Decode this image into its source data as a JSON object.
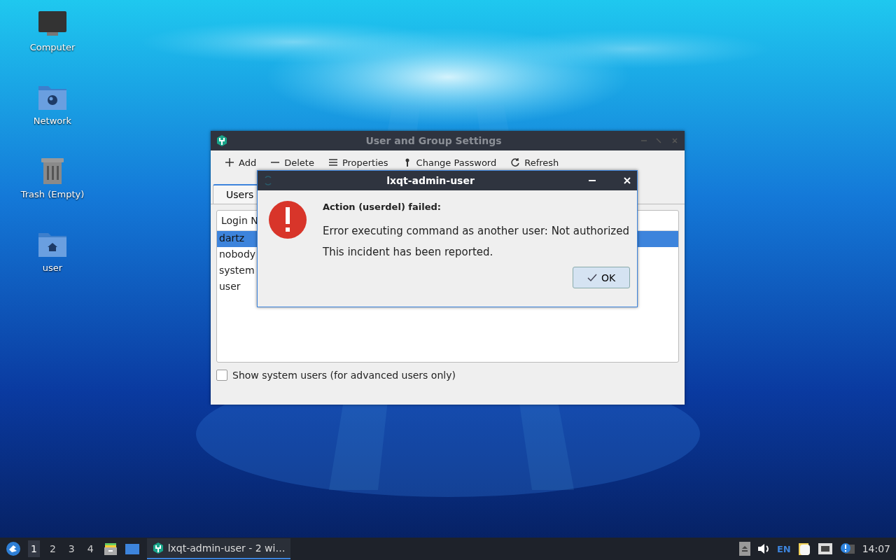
{
  "desktop_icons": [
    {
      "kind": "computer",
      "label": "Computer"
    },
    {
      "kind": "network",
      "label": "Network"
    },
    {
      "kind": "trash",
      "label": "Trash (Empty)"
    },
    {
      "kind": "home",
      "label": "user"
    }
  ],
  "main_window": {
    "title": "User and Group Settings",
    "toolbar": [
      {
        "kind": "add",
        "label": "Add"
      },
      {
        "kind": "delete",
        "label": "Delete"
      },
      {
        "kind": "properties",
        "label": "Properties"
      },
      {
        "kind": "password",
        "label": "Change Password"
      },
      {
        "kind": "refresh",
        "label": "Refresh"
      }
    ],
    "tabs": [
      {
        "label": "Users",
        "selected": true
      }
    ],
    "list": {
      "column": "Login N",
      "rows": [
        {
          "name": "dartz",
          "selected": true
        },
        {
          "name": "nobody",
          "selected": false
        },
        {
          "name": "system",
          "selected": false
        },
        {
          "name": "user",
          "selected": false
        }
      ]
    },
    "show_system_users": {
      "label": "Show system users (for advanced users only)",
      "checked": false
    }
  },
  "dialog": {
    "title": "lxqt-admin-user",
    "heading": "Action (userdel) failed:",
    "message": "Error executing command as another user: Not authorized",
    "note": "This incident has been reported.",
    "button": "OK"
  },
  "taskbar": {
    "desktops": [
      {
        "label": "1",
        "selected": true
      },
      {
        "label": "2",
        "selected": false
      },
      {
        "label": "3",
        "selected": false
      },
      {
        "label": "4",
        "selected": false
      }
    ],
    "task": "lxqt-admin-user - 2 wi…",
    "keyboard": "EN",
    "clock": "14:07"
  }
}
